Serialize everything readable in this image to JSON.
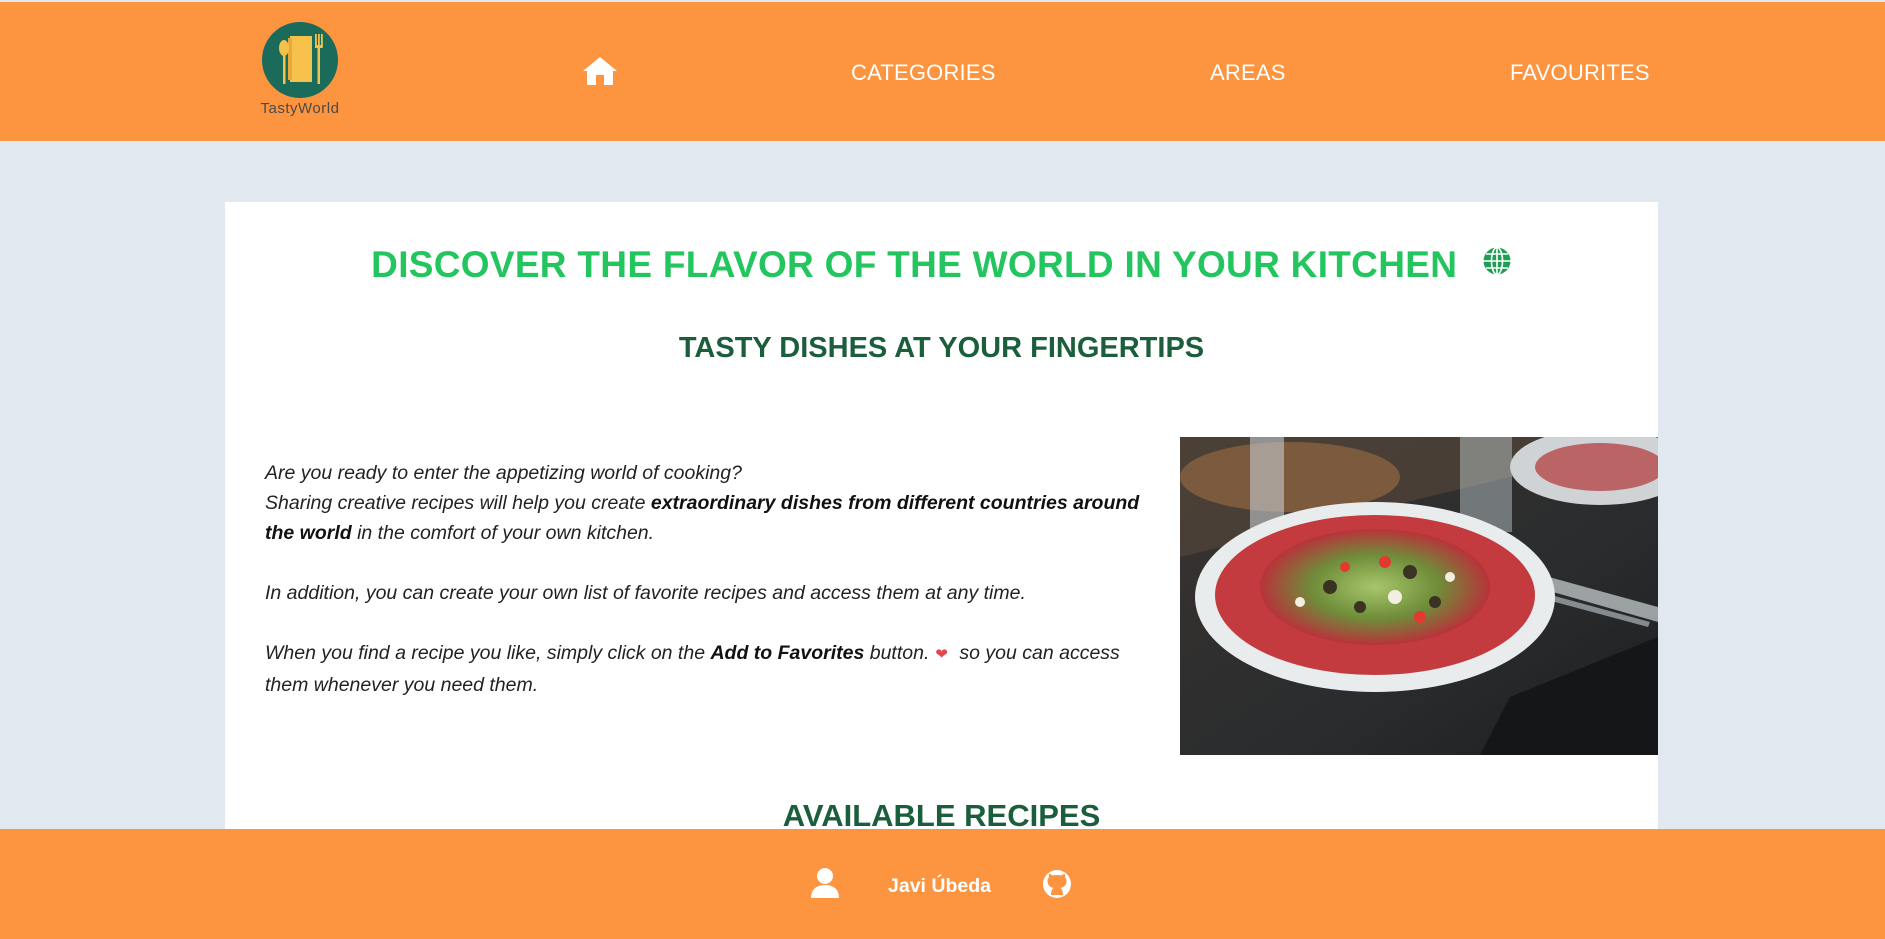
{
  "header": {
    "logo_text": "TastyWorld",
    "nav": {
      "categories": "CATEGORIES",
      "areas": "AREAS",
      "favourites": "FAVOURITES"
    }
  },
  "hero": {
    "title": "DISCOVER THE FLAVOR OF THE WORLD IN YOUR KITCHEN",
    "subtitle": "TASTY DISHES AT YOUR FINGERTIPS"
  },
  "intro": {
    "line1": "Are you ready to enter the appetizing world of cooking?",
    "line2_start": "Sharing creative recipes will help you create ",
    "line2_bold": "extraordinary dishes from different countries around the world",
    "line2_end": " in the comfort of your own kitchen.",
    "para2": "In addition, you can create your own list of favorite recipes and access them at any time.",
    "para3_start": "When you find a recipe you like, simply click on the ",
    "para3_bold": "Add to Favorites",
    "para3_mid": " button.",
    "para3_end": " so you can access them whenever you need them."
  },
  "recipes": {
    "title": "AVAILABLE RECIPES"
  },
  "footer": {
    "author": "Javi Úbeda"
  },
  "colors": {
    "header_bg": "#fd943f",
    "page_bg": "#e2e8f0",
    "title_green": "#22c55e",
    "dark_green": "#1b5e3b",
    "heart": "#e0484e"
  },
  "icons": {
    "home": "home-icon",
    "globe": "globe-icon",
    "heart": "heart-icon",
    "user": "user-icon",
    "github": "github-icon"
  }
}
